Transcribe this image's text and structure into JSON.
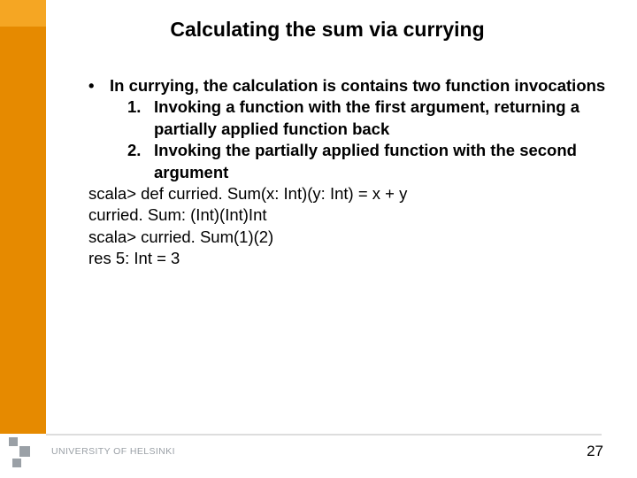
{
  "title": "Calculating the sum via currying",
  "bullet": {
    "marker": "•",
    "text": "In currying, the calculation is contains two function invocations"
  },
  "numbered": [
    {
      "num": "1.",
      "text": "Invoking a function with the first argument, returning a partially applied function back"
    },
    {
      "num": "2.",
      "text": "Invoking the partially applied function with the second argument"
    }
  ],
  "code_lines": [
    "scala> def curried. Sum(x: Int)(y: Int) = x + y",
    "curried. Sum: (Int)(Int)Int",
    "scala> curried. Sum(1)(2)",
    "res 5: Int = 3"
  ],
  "footer": {
    "institution": "UNIVERSITY OF HELSINKI"
  },
  "page_number": "27"
}
